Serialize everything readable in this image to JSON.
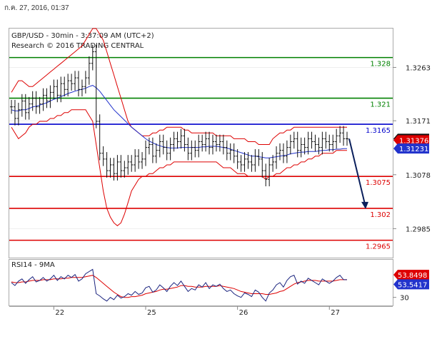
{
  "header": {
    "date_stamp": "ก.ค. 27, 2016, 01:37"
  },
  "chart_data": {
    "type": "line",
    "title": "GBP/USD - 30min - 3:37:09 AM (UTC+2)",
    "subtitle": "Research © 2016 TRADING CENTRAL",
    "price_axis": {
      "ylim": [
        1.2935,
        1.333
      ],
      "ticks": [
        "1.3263",
        "1.3171",
        "1.3078",
        "1.2985"
      ]
    },
    "x_axis": {
      "labels": [
        {
          "label": "22",
          "index": 12
        },
        {
          "label": "25",
          "index": 38
        },
        {
          "label": "26",
          "index": 64
        },
        {
          "label": "27",
          "index": 90
        }
      ],
      "count": 96
    },
    "levels": [
      {
        "label": "1.328",
        "value": 1.328,
        "color": "#008000"
      },
      {
        "label": "1.321",
        "value": 1.321,
        "color": "#008000"
      },
      {
        "label": "1.3165",
        "value": 1.3165,
        "color": "#0000cc"
      },
      {
        "label": "1.3075",
        "value": 1.3075,
        "color": "#dd0000"
      },
      {
        "label": "1.302",
        "value": 1.302,
        "color": "#dd0000"
      },
      {
        "label": "1.2965",
        "value": 1.2965,
        "color": "#dd0000"
      }
    ],
    "price_tags": [
      {
        "label": "1.314",
        "value": 1.314,
        "bg": "#111111",
        "fg": "#ffffff"
      },
      {
        "label": "1.31376",
        "value": 1.31376,
        "bg": "#dd0000",
        "fg": "#ffffff"
      },
      {
        "label": "1.31231",
        "value": 1.31231,
        "bg": "#2233cc",
        "fg": "#ffffff"
      }
    ],
    "close": [
      1.3195,
      1.3175,
      1.319,
      1.3205,
      1.3185,
      1.32,
      1.321,
      1.3195,
      1.32,
      1.3215,
      1.3205,
      1.322,
      1.323,
      1.3215,
      1.3235,
      1.3225,
      1.324,
      1.3235,
      1.3245,
      1.3225,
      1.323,
      1.3245,
      1.327,
      1.329,
      1.317,
      1.3115,
      1.3105,
      1.3085,
      1.3095,
      1.308,
      1.31,
      1.3085,
      1.309,
      1.31,
      1.3095,
      1.311,
      1.31,
      1.3105,
      1.3125,
      1.313,
      1.311,
      1.312,
      1.3135,
      1.3125,
      1.3115,
      1.313,
      1.314,
      1.3135,
      1.3145,
      1.313,
      1.3115,
      1.3125,
      1.312,
      1.3135,
      1.313,
      1.314,
      1.3125,
      1.3135,
      1.313,
      1.3135,
      1.3125,
      1.3115,
      1.312,
      1.311,
      1.31,
      1.3095,
      1.3105,
      1.31,
      1.3095,
      1.311,
      1.3105,
      1.3085,
      1.307,
      1.3095,
      1.31,
      1.3115,
      1.312,
      1.311,
      1.3125,
      1.3135,
      1.314,
      1.312,
      1.313,
      1.3125,
      1.314,
      1.3135,
      1.313,
      1.3125,
      1.314,
      1.3135,
      1.313,
      1.3135,
      1.3145,
      1.315,
      1.314,
      1.314
    ],
    "bollinger": {
      "upper": [
        1.322,
        1.323,
        1.324,
        1.324,
        1.3235,
        1.323,
        1.323,
        1.3235,
        1.324,
        1.3245,
        1.325,
        1.3255,
        1.326,
        1.3265,
        1.327,
        1.3275,
        1.328,
        1.3285,
        1.329,
        1.3295,
        1.33,
        1.331,
        1.332,
        1.333,
        1.333,
        1.332,
        1.331,
        1.329,
        1.327,
        1.325,
        1.323,
        1.321,
        1.319,
        1.317,
        1.316,
        1.3155,
        1.315,
        1.3145,
        1.3145,
        1.3145,
        1.315,
        1.315,
        1.3155,
        1.3155,
        1.316,
        1.316,
        1.316,
        1.316,
        1.316,
        1.3155,
        1.3155,
        1.315,
        1.315,
        1.315,
        1.315,
        1.315,
        1.315,
        1.315,
        1.3145,
        1.3145,
        1.3145,
        1.3145,
        1.3145,
        1.314,
        1.314,
        1.314,
        1.314,
        1.3135,
        1.3135,
        1.3135,
        1.313,
        1.313,
        1.313,
        1.313,
        1.314,
        1.3145,
        1.315,
        1.315,
        1.3155,
        1.3155,
        1.316,
        1.316,
        1.316,
        1.316,
        1.316,
        1.316,
        1.316,
        1.316,
        1.316,
        1.316,
        1.316,
        1.316,
        1.316,
        1.316,
        1.316,
        1.316
      ],
      "lower": [
        1.316,
        1.315,
        1.314,
        1.3145,
        1.315,
        1.316,
        1.3165,
        1.3165,
        1.317,
        1.317,
        1.317,
        1.3175,
        1.3175,
        1.318,
        1.318,
        1.3185,
        1.3185,
        1.319,
        1.319,
        1.319,
        1.319,
        1.319,
        1.318,
        1.317,
        1.313,
        1.309,
        1.305,
        1.302,
        1.3005,
        1.2995,
        1.299,
        1.2995,
        1.301,
        1.303,
        1.305,
        1.306,
        1.307,
        1.3075,
        1.3075,
        1.308,
        1.308,
        1.3085,
        1.309,
        1.309,
        1.3095,
        1.3095,
        1.31,
        1.31,
        1.31,
        1.31,
        1.31,
        1.31,
        1.31,
        1.31,
        1.31,
        1.31,
        1.31,
        1.31,
        1.31,
        1.3095,
        1.309,
        1.309,
        1.309,
        1.3085,
        1.308,
        1.308,
        1.308,
        1.3075,
        1.3075,
        1.3075,
        1.3075,
        1.3075,
        1.307,
        1.3075,
        1.3075,
        1.308,
        1.308,
        1.3085,
        1.309,
        1.309,
        1.3095,
        1.3095,
        1.31,
        1.31,
        1.3105,
        1.3105,
        1.311,
        1.311,
        1.3115,
        1.3115,
        1.3115,
        1.3115,
        1.312,
        1.312,
        1.312,
        1.312
      ]
    },
    "moving_average": [
      1.319,
      1.3188,
      1.3188,
      1.319,
      1.319,
      1.3192,
      1.3195,
      1.3196,
      1.3198,
      1.32,
      1.3202,
      1.3205,
      1.3208,
      1.321,
      1.3213,
      1.3215,
      1.3218,
      1.322,
      1.3222,
      1.3224,
      1.3225,
      1.3227,
      1.323,
      1.3232,
      1.3228,
      1.3222,
      1.3214,
      1.3206,
      1.3198,
      1.319,
      1.3184,
      1.3178,
      1.3172,
      1.3166,
      1.316,
      1.3155,
      1.315,
      1.3145,
      1.314,
      1.3136,
      1.3133,
      1.313,
      1.3128,
      1.3126,
      1.3125,
      1.3124,
      1.3124,
      1.3124,
      1.3125,
      1.3125,
      1.3125,
      1.3125,
      1.3125,
      1.3125,
      1.3126,
      1.3126,
      1.3127,
      1.3127,
      1.3127,
      1.3126,
      1.3125,
      1.3124,
      1.3122,
      1.312,
      1.3118,
      1.3116,
      1.3114,
      1.3112,
      1.311,
      1.311,
      1.3109,
      1.3108,
      1.3107,
      1.3107,
      1.3108,
      1.3109,
      1.311,
      1.3111,
      1.3112,
      1.3114,
      1.3115,
      1.3116,
      1.3117,
      1.3117,
      1.3118,
      1.3118,
      1.3118,
      1.3119,
      1.312,
      1.312,
      1.3121,
      1.3121,
      1.3122,
      1.3122,
      1.3123,
      1.3123
    ],
    "forecast_arrow": {
      "from_value": 1.314,
      "to_value": 1.302
    },
    "rsi": {
      "label": "RSI14 - 9MA",
      "ylim": [
        20,
        80
      ],
      "ticks": [
        "30"
      ],
      "tags": [
        {
          "label": "53.8498",
          "value": 53.85,
          "bg": "#dd0000",
          "fg": "#ffffff"
        },
        {
          "label": "53.5417",
          "value": 53.54,
          "bg": "#2233cc",
          "fg": "#ffffff"
        }
      ],
      "rsi_values": [
        50,
        46,
        52,
        55,
        49,
        54,
        58,
        51,
        53,
        57,
        52,
        55,
        60,
        53,
        58,
        55,
        60,
        57,
        61,
        52,
        55,
        62,
        65,
        68,
        35,
        32,
        28,
        25,
        30,
        27,
        33,
        29,
        31,
        35,
        33,
        38,
        34,
        36,
        43,
        45,
        37,
        40,
        47,
        43,
        38,
        45,
        50,
        46,
        52,
        45,
        38,
        42,
        40,
        47,
        44,
        50,
        42,
        47,
        45,
        48,
        42,
        38,
        40,
        35,
        32,
        30,
        36,
        34,
        31,
        40,
        37,
        30,
        25,
        36,
        40,
        47,
        50,
        44,
        53,
        58,
        60,
        48,
        52,
        49,
        56,
        53,
        50,
        47,
        55,
        52,
        49,
        52,
        57,
        60,
        54,
        54
      ],
      "ma_values": [
        51,
        50,
        50,
        51,
        51,
        52,
        53,
        53,
        53,
        54,
        54,
        54,
        55,
        55,
        55,
        56,
        56,
        57,
        57,
        57,
        57,
        58,
        59,
        60,
        57,
        53,
        49,
        45,
        41,
        37,
        34,
        31,
        30,
        30,
        31,
        31,
        32,
        33,
        35,
        36,
        37,
        38,
        40,
        41,
        41,
        42,
        43,
        44,
        46,
        46,
        45,
        45,
        44,
        44,
        44,
        45,
        45,
        45,
        45,
        46,
        45,
        44,
        43,
        42,
        40,
        38,
        37,
        36,
        35,
        35,
        35,
        35,
        34,
        34,
        35,
        36,
        38,
        39,
        42,
        45,
        48,
        50,
        51,
        52,
        53,
        53,
        53,
        52,
        52,
        52,
        52,
        52,
        53,
        54,
        54,
        54
      ]
    }
  }
}
